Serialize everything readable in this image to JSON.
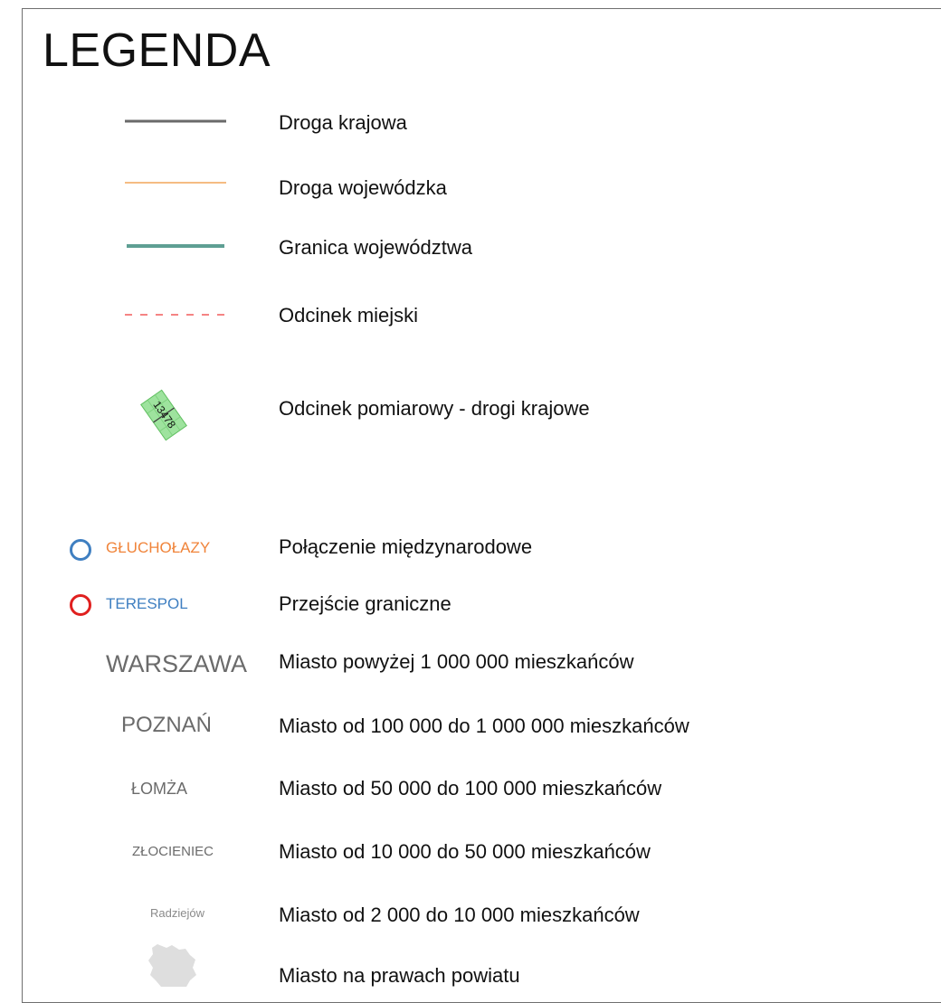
{
  "title": "LEGENDA",
  "colors": {
    "national_road": "#6a6a6a",
    "voivodeship_road": "#f2a65a",
    "voivodeship_border": "#5e9f93",
    "city_segment": "#ef3b3b",
    "international_ring": "#3f7fc1",
    "international_label": "#f0843a",
    "border_ring": "#e0201f",
    "border_label": "#3f7fc1",
    "city_label": "#6b6b6b",
    "measurement_fill": "#9ee39e"
  },
  "items": {
    "national_road": "Droga krajowa",
    "voivodeship_road": "Droga wojewódzka",
    "voivodeship_border": "Granica województwa",
    "city_segment": "Odcinek miejski",
    "measurement_segment": "Odcinek pomiarowy - drogi krajowe",
    "measurement_code": "13478",
    "international": "Połączenie międzynarodowe",
    "international_example": "GŁUCHOŁAZY",
    "border_crossing": "Przejście graniczne",
    "border_example": "TERESPOL",
    "city_1m": "Miasto powyżej 1 000 000 mieszkańców",
    "city_1m_example": "WARSZAWA",
    "city_100k": "Miasto od 100 000 do 1 000 000 mieszkańców",
    "city_100k_example": "POZNAŃ",
    "city_50k": "Miasto od 50 000 do 100 000 mieszkańców",
    "city_50k_example": "ŁOMŻA",
    "city_10k": "Miasto od 10 000 do 50 000 mieszkańców",
    "city_10k_example": "ZŁOCIENIEC",
    "city_2k": "Miasto od 2 000 do 10 000 mieszkańców",
    "city_2k_example": "Radziejów",
    "county_city": "Miasto na prawach powiatu"
  }
}
